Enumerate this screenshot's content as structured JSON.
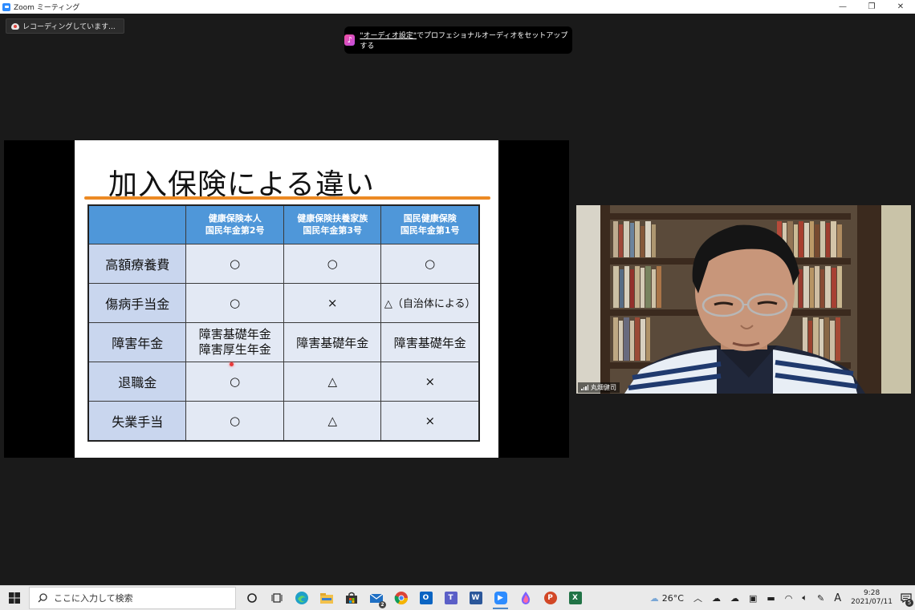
{
  "window": {
    "title": "Zoom ミーティング",
    "minimize": "—",
    "restore": "❐",
    "close": "✕"
  },
  "recording": {
    "label": "レコーディングしています..."
  },
  "audio_banner": {
    "link": "\"オーディオ設定\"",
    "text": "でプロフェショナルオーディオをセットアップする"
  },
  "slide": {
    "title": "加入保険による違い",
    "headers": [
      "",
      "健康保険本人\n国民年金第2号",
      "健康保険扶養家族\n国民年金第3号",
      "国民健康保険\n国民年金第1号"
    ],
    "rows": [
      {
        "label": "高額療養費",
        "cells": [
          "○",
          "○",
          "○"
        ]
      },
      {
        "label": "傷病手当金",
        "cells": [
          "○",
          "×",
          "△（自治体による）"
        ]
      },
      {
        "label": "障害年金",
        "cells": [
          "障害基礎年金\n障害厚生年金",
          "障害基礎年金",
          "障害基礎年金"
        ]
      },
      {
        "label": "退職金",
        "cells": [
          "○",
          "△",
          "×"
        ]
      },
      {
        "label": "失業手当",
        "cells": [
          "○",
          "△",
          "×"
        ]
      }
    ],
    "colors": {
      "header_bg": "#4f97d9",
      "label_bg": "#c9d6ee",
      "cell_bg": "#e3e9f4",
      "underline": "#ec8a24"
    }
  },
  "participant": {
    "name": "丸畑健司"
  },
  "taskbar": {
    "search_placeholder": "ここに入力して検索",
    "weather": "26°C",
    "ime": "A",
    "time": "9:28",
    "date": "2021/07/11",
    "notification_count": "5",
    "outlook_badge": "2"
  }
}
